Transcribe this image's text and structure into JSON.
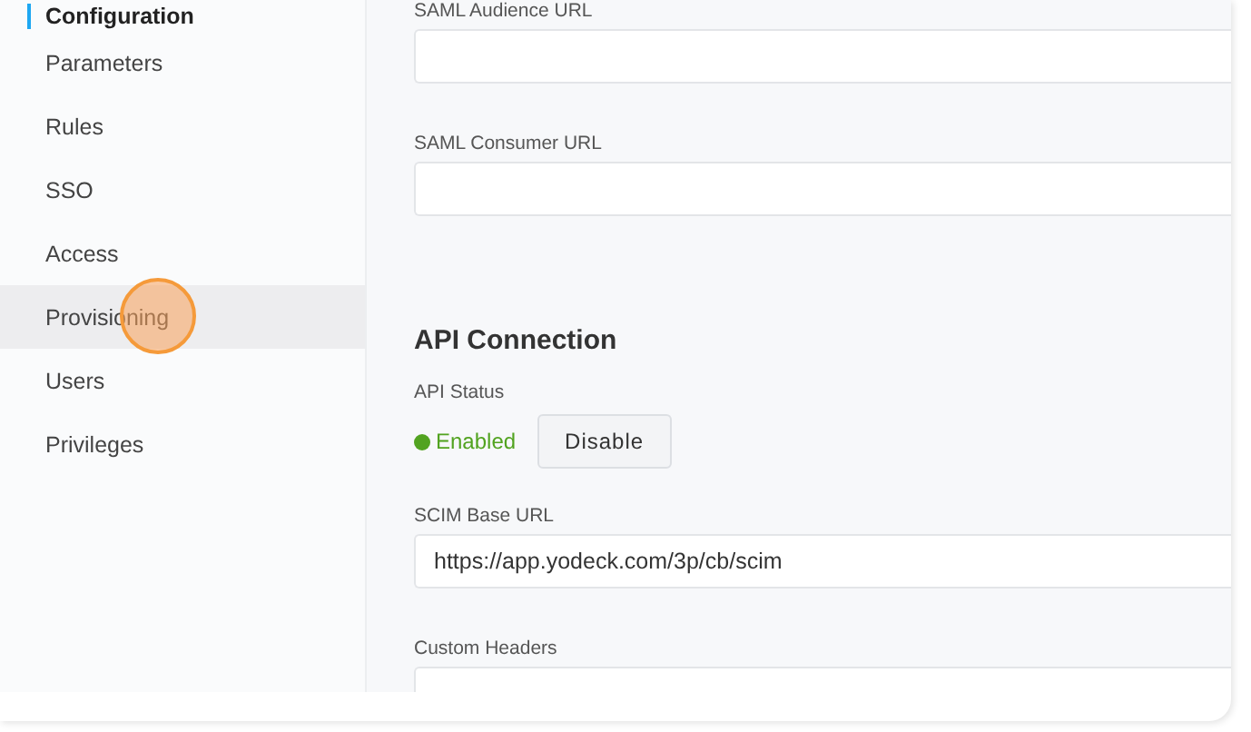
{
  "sidebar": {
    "items": [
      {
        "label": "Configuration",
        "selected": true,
        "highlighted": false
      },
      {
        "label": "Parameters",
        "selected": false,
        "highlighted": false
      },
      {
        "label": "Rules",
        "selected": false,
        "highlighted": false
      },
      {
        "label": "SSO",
        "selected": false,
        "highlighted": false
      },
      {
        "label": "Access",
        "selected": false,
        "highlighted": false
      },
      {
        "label": "Provisioning",
        "selected": false,
        "highlighted": true,
        "click_marker": true
      },
      {
        "label": "Users",
        "selected": false,
        "highlighted": false
      },
      {
        "label": "Privileges",
        "selected": false,
        "highlighted": false
      }
    ]
  },
  "saml": {
    "fields": [
      {
        "label": "SAML Audience URL"
      },
      {
        "label": "SAML Consumer URL"
      }
    ]
  },
  "api_connection": {
    "heading": "API Connection",
    "status_label": "API Status",
    "status": {
      "text": "Enabled",
      "enabled": true,
      "color": "#52a320"
    },
    "button": "Disable",
    "fields": [
      {
        "label": "SCIM Base URL",
        "value": "https://app.yodeck.com/3p/cb/scim"
      },
      {
        "label": "Custom Headers"
      }
    ]
  }
}
